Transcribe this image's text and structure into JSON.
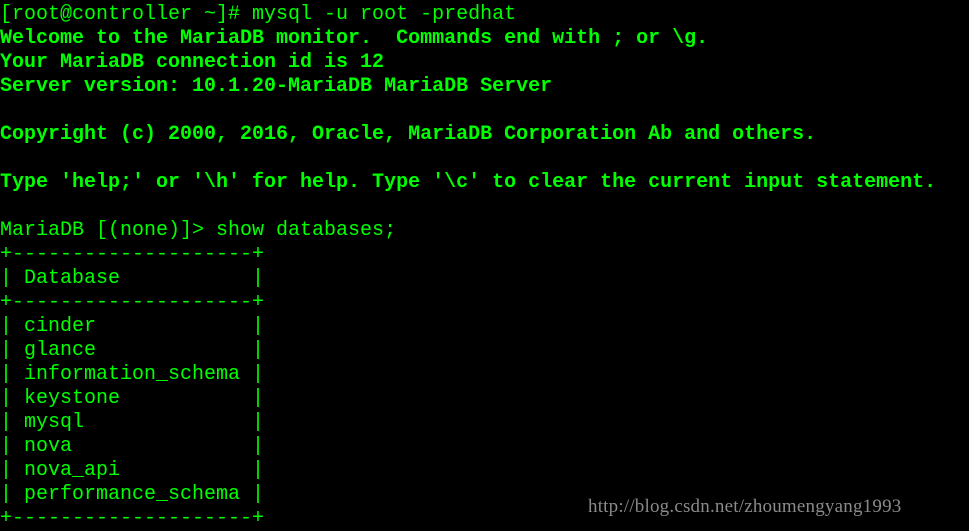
{
  "terminal": {
    "text_color": "#00ff00",
    "background": "#000000",
    "lines": [
      {
        "text": "[root@controller ~]# mysql -u root -predhat",
        "bold": false
      },
      {
        "text": "Welcome to the MariaDB monitor.  Commands end with ; or \\g.",
        "bold": true
      },
      {
        "text": "Your MariaDB connection id is 12",
        "bold": true
      },
      {
        "text": "Server version: 10.1.20-MariaDB MariaDB Server",
        "bold": true
      },
      {
        "text": "",
        "bold": false
      },
      {
        "text": "Copyright (c) 2000, 2016, Oracle, MariaDB Corporation Ab and others.",
        "bold": true
      },
      {
        "text": "",
        "bold": false
      },
      {
        "text": "Type 'help;' or '\\h' for help. Type '\\c' to clear the current input statement.",
        "bold": true
      },
      {
        "text": "",
        "bold": false
      },
      {
        "text": "MariaDB [(none)]> show databases;",
        "bold": false
      },
      {
        "text": "+--------------------+",
        "bold": false
      },
      {
        "text": "| Database           |",
        "bold": false
      },
      {
        "text": "+--------------------+",
        "bold": false
      },
      {
        "text": "| cinder             |",
        "bold": false
      },
      {
        "text": "| glance             |",
        "bold": false
      },
      {
        "text": "| information_schema |",
        "bold": false
      },
      {
        "text": "| keystone           |",
        "bold": false
      },
      {
        "text": "| mysql              |",
        "bold": false
      },
      {
        "text": "| nova               |",
        "bold": false
      },
      {
        "text": "| nova_api           |",
        "bold": false
      },
      {
        "text": "| performance_schema |",
        "bold": false
      },
      {
        "text": "+--------------------+",
        "bold": false
      }
    ]
  },
  "watermark": "http://blog.csdn.net/zhoumengyang1993"
}
